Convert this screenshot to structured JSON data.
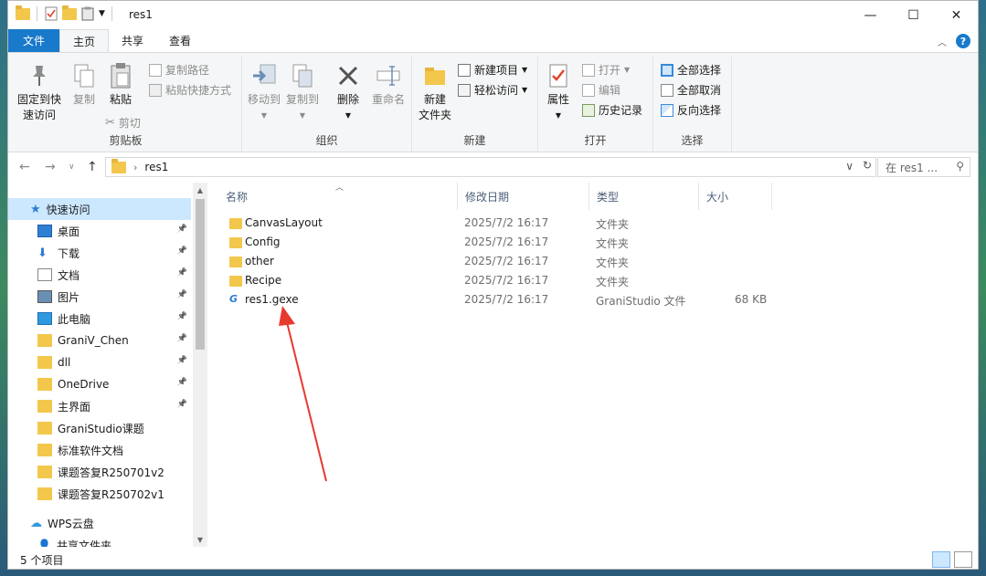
{
  "window": {
    "title": "res1",
    "controls": {
      "minimize": "—",
      "maximize": "☐",
      "close": "✕"
    }
  },
  "ribbon_tabs": [
    {
      "label": "文件"
    },
    {
      "label": "主页"
    },
    {
      "label": "共享"
    },
    {
      "label": "查看"
    }
  ],
  "ribbon": {
    "clipboard": {
      "label": "剪贴板",
      "pin_quick_access": "固定到快\n速访问",
      "pin_line1": "固定到快",
      "pin_line2": "速访问",
      "copy": "复制",
      "paste": "粘贴",
      "copy_path": "复制路径",
      "paste_shortcut": "粘贴快捷方式",
      "cut": "剪切"
    },
    "organize": {
      "label": "组织",
      "move_to": "移动到",
      "copy_to": "复制到",
      "delete": "删除",
      "rename": "重命名"
    },
    "new": {
      "label": "新建",
      "new_folder_line1": "新建",
      "new_folder_line2": "文件夹",
      "new_item": "新建项目",
      "easy_access": "轻松访问"
    },
    "open": {
      "label": "打开",
      "properties": "属性",
      "open": "打开",
      "edit": "编辑",
      "history": "历史记录"
    },
    "select": {
      "label": "选择",
      "select_all": "全部选择",
      "select_none": "全部取消",
      "invert": "反向选择"
    }
  },
  "address": {
    "path": "res1",
    "search_placeholder": "在 res1 ..."
  },
  "nav_pane": {
    "quick_access": "快速访问",
    "items": [
      {
        "label": "桌面",
        "icon": "desktop-icon",
        "pinned": true
      },
      {
        "label": "下载",
        "icon": "download-icon",
        "pinned": true
      },
      {
        "label": "文档",
        "icon": "document-icon",
        "pinned": true
      },
      {
        "label": "图片",
        "icon": "picture-icon",
        "pinned": true
      },
      {
        "label": "此电脑",
        "icon": "computer-icon",
        "pinned": true
      },
      {
        "label": "GraniV_Chen",
        "icon": "folder-icon",
        "pinned": true
      },
      {
        "label": "dll",
        "icon": "folder-icon",
        "pinned": true
      },
      {
        "label": "OneDrive",
        "icon": "folder-icon",
        "pinned": true
      },
      {
        "label": "主界面",
        "icon": "folder-icon",
        "pinned": true
      },
      {
        "label": "GraniStudio课题",
        "icon": "folder-icon",
        "pinned": false
      },
      {
        "label": "标准软件文档",
        "icon": "folder-icon",
        "pinned": false
      },
      {
        "label": "课题答复R250701v2",
        "icon": "folder-icon",
        "pinned": false
      },
      {
        "label": "课题答复R250702v1",
        "icon": "folder-icon",
        "pinned": false
      }
    ],
    "wps": "WPS云盘",
    "shared": "共享文件夹"
  },
  "columns": {
    "name": "名称",
    "date": "修改日期",
    "type": "类型",
    "size": "大小"
  },
  "files": [
    {
      "name": "CanvasLayout",
      "date": "2025/7/2 16:17",
      "type": "文件夹",
      "size": ""
    },
    {
      "name": "Config",
      "date": "2025/7/2 16:17",
      "type": "文件夹",
      "size": ""
    },
    {
      "name": "other",
      "date": "2025/7/2 16:17",
      "type": "文件夹",
      "size": ""
    },
    {
      "name": "Recipe",
      "date": "2025/7/2 16:17",
      "type": "文件夹",
      "size": ""
    },
    {
      "name": "res1.gexe",
      "date": "2025/7/2 16:17",
      "type": "GraniStudio 文件",
      "size": "68 KB"
    }
  ],
  "status": {
    "count": "5 个项目"
  },
  "colors": {
    "accent": "#1979ca",
    "annotation_arrow": "#e8392f",
    "folder": "#f3c74c"
  }
}
